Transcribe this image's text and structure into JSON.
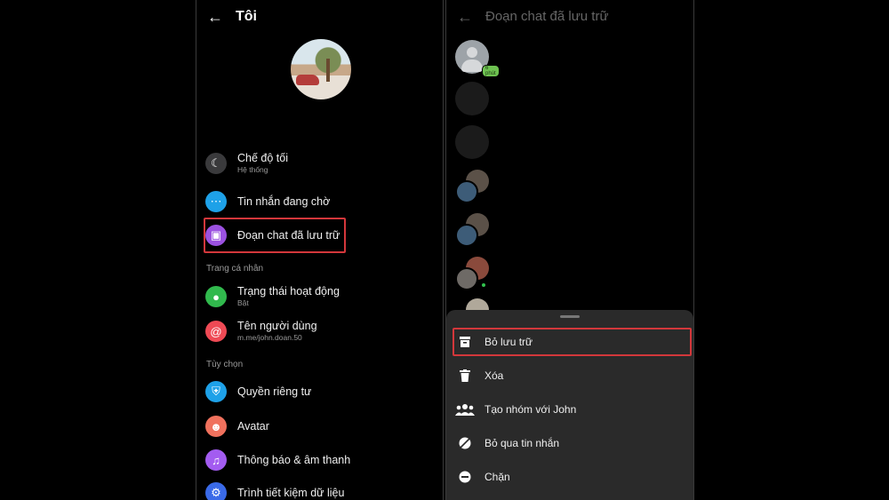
{
  "left": {
    "title": "Tôi",
    "rows": [
      {
        "label": "Chế độ tối",
        "sub": "Hệ thống",
        "icon": "moon-icon",
        "color": "#3a3a3c"
      },
      {
        "label": "Tin nhắn đang chờ",
        "icon": "chat-bubble-icon",
        "color": "#1ea1e8"
      },
      {
        "label": "Đoạn chat đã lưu trữ",
        "icon": "archive-icon",
        "color": "#9b51e0"
      },
      {
        "label": "Trạng thái hoạt động",
        "sub": "Bật",
        "icon": "activity-status-icon",
        "color": "#31b94d"
      },
      {
        "label": "Tên người dùng",
        "sub": "m.me/john.doan.50",
        "icon": "at-sign-icon",
        "color": "#ef4a55"
      },
      {
        "label": "Quyền riêng tư",
        "icon": "shield-icon",
        "color": "#1ea1e8"
      },
      {
        "label": "Avatar",
        "icon": "avatar-icon",
        "color": "#f0715d"
      },
      {
        "label": "Thông báo & âm thanh",
        "icon": "bell-icon",
        "color": "#a35cf0"
      },
      {
        "label": "Trình tiết kiệm dữ liệu",
        "icon": "data-saver-icon",
        "color": "#3a6ae8"
      }
    ],
    "sections": {
      "profile": "Trang cá nhân",
      "options": "Tùy chọn"
    }
  },
  "right": {
    "title": "Đoạn chat đã lưu trữ",
    "time_badge": "6 phút",
    "actions": [
      {
        "label": "Bỏ lưu trữ",
        "icon": "unarchive-icon"
      },
      {
        "label": "Xóa",
        "icon": "trash-icon"
      },
      {
        "label": "Tạo nhóm với John",
        "icon": "people-icon"
      },
      {
        "label": "Bỏ qua tin nhắn",
        "icon": "ignore-icon"
      },
      {
        "label": "Chặn",
        "icon": "block-icon"
      }
    ]
  },
  "colors": {
    "highlight": "#d3373b",
    "background": "#000000",
    "sheet": "#2a2a2a"
  }
}
